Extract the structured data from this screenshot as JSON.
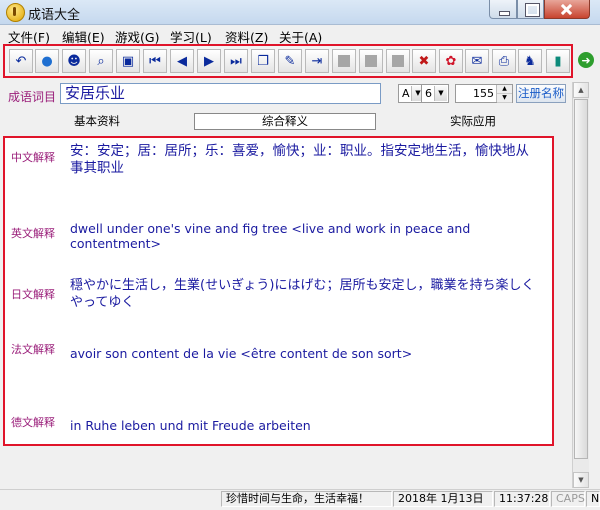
{
  "window": {
    "title": "成语大全"
  },
  "menu": [
    "文件(F)",
    "编辑(E)",
    "游戏(G)",
    "学习(L)",
    "资料(Z)",
    "关于(A)"
  ],
  "toolbar": {
    "buttons": [
      {
        "name": "undo-icon",
        "glyph": "↶"
      },
      {
        "name": "globe-icon",
        "glyph": "●"
      },
      {
        "name": "people-icon",
        "glyph": "☻"
      },
      {
        "name": "search-doc-icon",
        "glyph": "⌕"
      },
      {
        "name": "picture-icon",
        "glyph": "▣"
      },
      {
        "name": "first-icon",
        "glyph": "⏮"
      },
      {
        "name": "prev-icon",
        "glyph": "◀"
      },
      {
        "name": "next-icon",
        "glyph": "▶"
      },
      {
        "name": "last-icon",
        "glyph": "⏭"
      },
      {
        "name": "copy-icon",
        "glyph": "❐"
      },
      {
        "name": "edit-icon",
        "glyph": "✎"
      },
      {
        "name": "export-icon",
        "glyph": "⇥"
      },
      {
        "name": "disabled-a-icon",
        "glyph": ""
      },
      {
        "name": "disabled-b-icon",
        "glyph": ""
      },
      {
        "name": "disabled-c-icon",
        "glyph": ""
      },
      {
        "name": "delete-icon",
        "glyph": "✖"
      },
      {
        "name": "flower-icon",
        "glyph": "✿"
      },
      {
        "name": "mail-icon",
        "glyph": "✉"
      },
      {
        "name": "print-icon",
        "glyph": "⎙"
      },
      {
        "name": "rabbit-icon",
        "glyph": "♞"
      },
      {
        "name": "exit-door-icon",
        "glyph": "▮"
      }
    ]
  },
  "entry": {
    "label": "成语词目",
    "value": "安居乐业",
    "font_select": "A",
    "size_select": "6",
    "record_number": "155",
    "register_button": "注册名称"
  },
  "tabs": [
    "基本资料",
    "综合释义",
    "实际应用"
  ],
  "active_tab": "综合释义",
  "definitions": {
    "zh": {
      "label": "中文解释",
      "text": "安：安定；居：居所；乐：喜爱，愉快；业：职业。指安定地生活，愉快地从事其职业"
    },
    "en": {
      "label": "英文解释",
      "text": "dwell under one's vine and fig tree <live and work in peace and contentment>"
    },
    "ja": {
      "label": "日文解释",
      "text": "穏やかに生活し，生業(せいぎょう)にはげむ；居所も安定し，職業を持ち楽しくやってゆく"
    },
    "fr": {
      "label": "法文解释",
      "text": "avoir son content de la vie <être content de son sort>"
    },
    "de": {
      "label": "德文解释",
      "text": "in Ruhe leben und mit Freude arbeiten"
    }
  },
  "status": {
    "motto": "珍惜时间与生命，生活幸福！",
    "date": "2018年 1月13日",
    "time": "11:37:28",
    "caps": "CAPS",
    "num": "N"
  },
  "colors": {
    "highlight_border": "#e0142a",
    "label": "#9a1e7a",
    "text": "#1a1aa0"
  }
}
